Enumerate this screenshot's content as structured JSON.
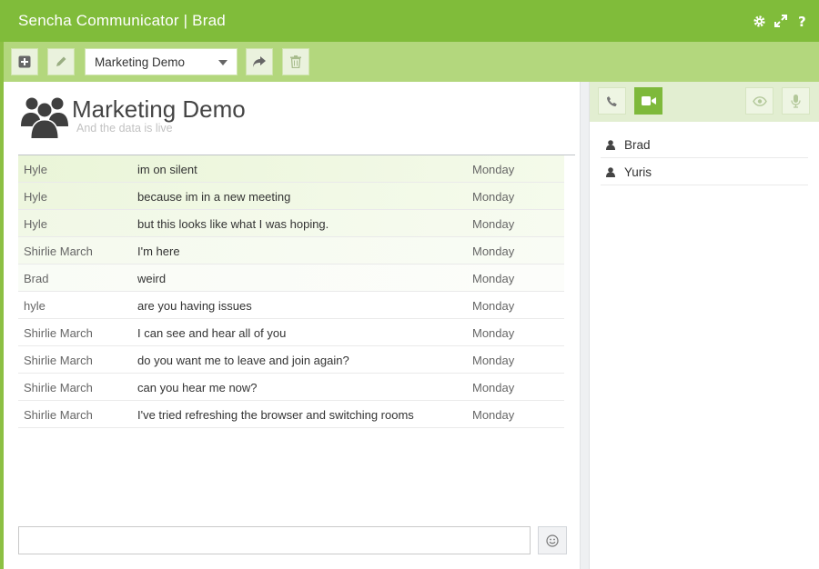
{
  "app": {
    "title": "Sencha Communicator | Brad",
    "header_icons": [
      "gear-icon",
      "expand-icon",
      "help-icon"
    ]
  },
  "toolbar": {
    "buttons": [
      "add-icon",
      "edit-icon",
      "share-icon",
      "trash-icon"
    ],
    "room_select_value": "Marketing Demo"
  },
  "room": {
    "name": "Marketing Demo",
    "subtitle": "And the data is live"
  },
  "messages": [
    {
      "user": "Hyle",
      "text": "im on silent",
      "date": "Monday"
    },
    {
      "user": "Hyle",
      "text": "because im in a new meeting",
      "date": "Monday"
    },
    {
      "user": "Hyle",
      "text": "but this looks like what I was hoping.",
      "date": "Monday"
    },
    {
      "user": "Shirlie March",
      "text": "I'm here",
      "date": "Monday"
    },
    {
      "user": "Brad",
      "text": "weird",
      "date": "Monday"
    },
    {
      "user": "hyle",
      "text": "are you having issues",
      "date": "Monday"
    },
    {
      "user": "Shirlie March",
      "text": "I can see and hear all of you",
      "date": "Monday"
    },
    {
      "user": "Shirlie March",
      "text": "do you want me to leave and join again?",
      "date": "Monday"
    },
    {
      "user": "Shirlie March",
      "text": "can you hear me now?",
      "date": "Monday"
    },
    {
      "user": "Shirlie March",
      "text": "I've tried refreshing the browser and switching rooms",
      "date": "Monday"
    }
  ],
  "composer": {
    "value": "",
    "emoji_icon": "smiley-icon"
  },
  "side_toolbar": {
    "buttons": [
      "phone-icon",
      "video-icon",
      "eye-icon",
      "microphone-icon"
    ],
    "active": "video-icon"
  },
  "participants": [
    "Brad",
    "Yuris"
  ],
  "colors": {
    "header": "#80bc3a",
    "toolbar": "#b3d77d",
    "accent": "#7eb93b",
    "new_message_highlight": "#eef7de"
  }
}
